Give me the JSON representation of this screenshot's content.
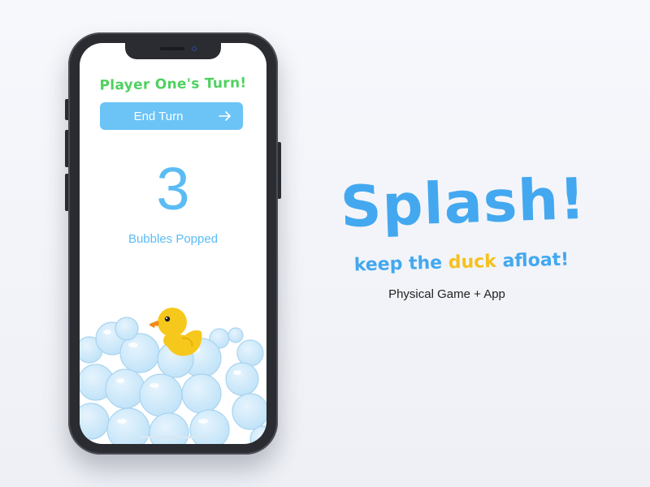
{
  "game_screen": {
    "turn_title": "Player One's Turn!",
    "end_turn_label": "End Turn",
    "bubbles_popped_count": "3",
    "bubbles_popped_label": "Bubbles Popped"
  },
  "branding": {
    "title": "Splash!",
    "tagline_prefix": "keep the ",
    "tagline_highlight": "duck",
    "tagline_suffix": " afloat!",
    "subtitle": "Physical Game + App"
  },
  "icons": {
    "end_turn_arrow": "arrow-right-icon",
    "duck": "rubber-duck-icon",
    "bubbles": "bubbles-icon"
  },
  "colors": {
    "turn_title": "#4fd160",
    "button_bg": "#6cc3f6",
    "count": "#5bbcf4",
    "brand_blue": "#43a8ef",
    "brand_yellow": "#f5c11e",
    "duck_yellow": "#f7c81c",
    "duck_beak": "#f08a1c"
  }
}
